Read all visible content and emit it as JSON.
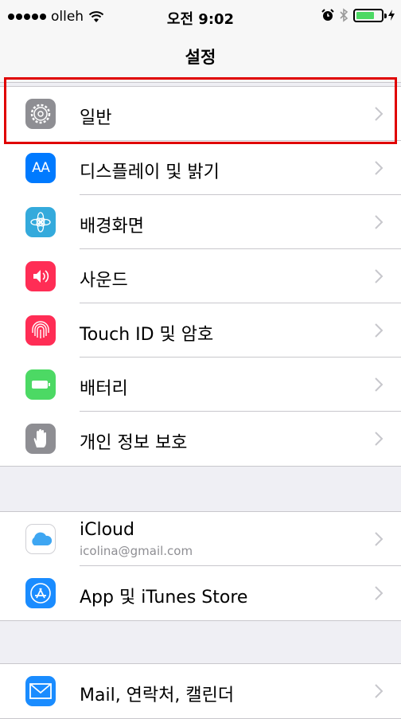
{
  "status_bar": {
    "carrier": "olleh",
    "time": "오전 9:02"
  },
  "nav": {
    "title": "설정"
  },
  "groups": [
    {
      "items": [
        {
          "label": "일반",
          "icon": "gear-icon",
          "color": "#8e8e93"
        },
        {
          "label": "디스플레이 및 밝기",
          "icon": "text-size-icon",
          "icon_text": "AA",
          "color": "#007aff"
        },
        {
          "label": "배경화면",
          "icon": "flower-icon",
          "color": "#34aadc"
        },
        {
          "label": "사운드",
          "icon": "speaker-icon",
          "color": "#ff2d55"
        },
        {
          "label": "Touch ID 및 암호",
          "icon": "fingerprint-icon",
          "color": "#ff2d55"
        },
        {
          "label": "배터리",
          "icon": "battery-icon",
          "color": "#4cd964"
        },
        {
          "label": "개인 정보 보호",
          "icon": "hand-icon",
          "color": "#8e8e93"
        }
      ]
    },
    {
      "items": [
        {
          "label": "iCloud",
          "sublabel": "icolina@gmail.com",
          "icon": "cloud-icon",
          "color": "#ffffff"
        },
        {
          "label": "App 및 iTunes Store",
          "icon": "app-store-icon",
          "color": "#1a8cff"
        }
      ]
    },
    {
      "items": [
        {
          "label": "Mail, 연락처, 캘린더",
          "icon": "mail-icon",
          "color": "#1a8cff"
        }
      ]
    }
  ]
}
